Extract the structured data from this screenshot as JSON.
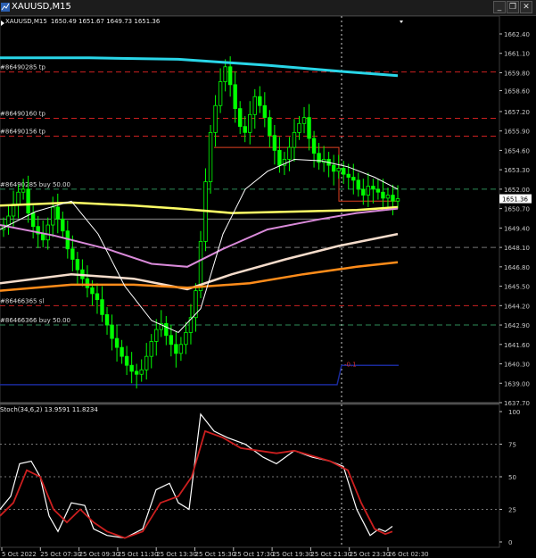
{
  "window": {
    "title": "XAUUSD,M15",
    "ohlc": "1650.49 1651.67 1649.73 1651.36",
    "buttons": {
      "minimize": "_",
      "restore": "❐",
      "close": "✕"
    }
  },
  "colors": {
    "background": "#000000",
    "bull_candle": "#00ff00",
    "ma_cyan": "#29d6e8",
    "ma_yellow": "#ffff66",
    "ma_violet": "#d98ad9",
    "ma_peach": "#f5dccb",
    "ma_orange": "#ff8c1a",
    "bollinger": "#ffffff",
    "stoch_main": "#ffffff",
    "stoch_signal": "#cc1f1f",
    "order_line": "#e04020",
    "sl_line": "#cc2020",
    "tp_line": "#cc2020",
    "level_navy": "#1a2a9a",
    "price_box": "#ffffff"
  },
  "order_labels": [
    {
      "text": "#86490285 tp",
      "price": 1659.85
    },
    {
      "text": "#86490160 tp",
      "price": 1656.75
    },
    {
      "text": "#86490156 tp",
      "price": 1655.55
    },
    {
      "text": "#86490285 buy 50.00",
      "price": 1652.0
    },
    {
      "text": "#86466365 sl",
      "price": 1644.2
    },
    {
      "text": "#86466366 buy 50.00",
      "price": 1642.9
    }
  ],
  "marker": {
    "text": "-0.1"
  },
  "price_axis": {
    "ticks": [
      "1662.40",
      "1661.10",
      "1659.80",
      "1658.60",
      "1657.20",
      "1655.90",
      "1654.60",
      "1653.30",
      "1652.00",
      "1650.70",
      "1649.40",
      "1648.10",
      "1646.80",
      "1645.50",
      "1644.20",
      "1642.90",
      "1641.60",
      "1640.30",
      "1639.00",
      "1637.70"
    ],
    "current_price": "1651.36"
  },
  "indicator": {
    "label": "Stoch(34,6,2) 13.9591 11.8234",
    "levels": [
      "100",
      "75",
      "50",
      "25",
      "0"
    ]
  },
  "time_axis": {
    "labels": [
      "5 Oct 2022",
      "25 Oct 07:30",
      "25 Oct 09:30",
      "25 Oct 11:30",
      "25 Oct 13:30",
      "25 Oct 15:30",
      "25 Oct 17:30",
      "25 Oct 19:30",
      "25 Oct 21:30",
      "25 Oct 23:30",
      "26 Oct 02:30"
    ]
  }
}
